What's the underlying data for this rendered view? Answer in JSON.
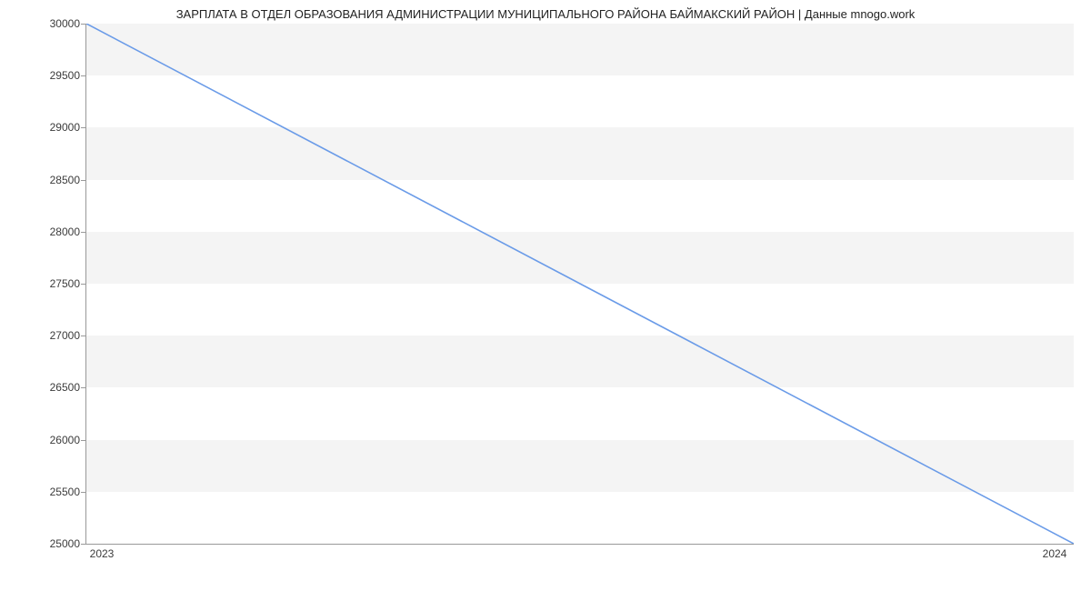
{
  "chart_data": {
    "type": "line",
    "title": "ЗАРПЛАТА В ОТДЕЛ ОБРАЗОВАНИЯ АДМИНИСТРАЦИИ МУНИЦИПАЛЬНОГО РАЙОНА БАЙМАКСКИЙ РАЙОН | Данные mnogo.work",
    "x": [
      2023,
      2024
    ],
    "values": [
      30000,
      25000
    ],
    "xlabel": "",
    "ylabel": "",
    "xticks": [
      2023,
      2024
    ],
    "yticks": [
      25000,
      25500,
      26000,
      26500,
      27000,
      27500,
      28000,
      28500,
      29000,
      29500,
      30000
    ],
    "ylim": [
      25000,
      30000
    ],
    "line_color": "#6a9be8"
  }
}
